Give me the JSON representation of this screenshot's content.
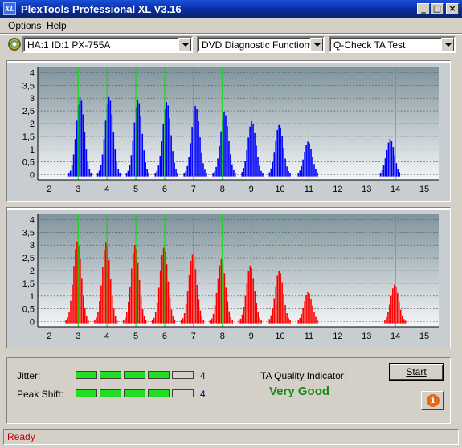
{
  "window": {
    "title": "PlexTools Professional XL V3.16",
    "logo_text": "XL"
  },
  "menu": [
    {
      "label": "Options"
    },
    {
      "label": "Help"
    }
  ],
  "toolbar": {
    "drive_select": "HA:1 ID:1  PX-755A",
    "function_select": "DVD Diagnostic Functions",
    "test_select": "Q-Check TA Test"
  },
  "chart_data": [
    {
      "type": "bar",
      "color": "#0000ff",
      "x_ticks": [
        "2",
        "3",
        "4",
        "5",
        "6",
        "7",
        "8",
        "9",
        "10",
        "11",
        "12",
        "13",
        "14",
        "15"
      ],
      "y_ticks": [
        "0",
        "0,5",
        "1",
        "1,5",
        "2",
        "2,5",
        "3",
        "3,5",
        "4"
      ],
      "xlim": [
        1.6,
        15.5
      ],
      "ylim": [
        -0.2,
        4.2
      ],
      "grid_lines_at": [
        3,
        4,
        5,
        6,
        7,
        8,
        9,
        10,
        11,
        14
      ],
      "peaks": [
        {
          "center": 3.05,
          "height": 3.05
        },
        {
          "center": 4.05,
          "height": 3.05
        },
        {
          "center": 5.05,
          "height": 2.95
        },
        {
          "center": 6.05,
          "height": 2.85
        },
        {
          "center": 7.05,
          "height": 2.7
        },
        {
          "center": 8.05,
          "height": 2.45
        },
        {
          "center": 9.0,
          "height": 2.1
        },
        {
          "center": 9.95,
          "height": 1.95
        },
        {
          "center": 10.95,
          "height": 1.3
        },
        {
          "center": 13.8,
          "height": 1.4
        }
      ]
    },
    {
      "type": "bar",
      "color": "#ff0000",
      "x_ticks": [
        "2",
        "3",
        "4",
        "5",
        "6",
        "7",
        "8",
        "9",
        "10",
        "11",
        "12",
        "13",
        "14",
        "15"
      ],
      "y_ticks": [
        "0",
        "0,5",
        "1",
        "1,5",
        "2",
        "2,5",
        "3",
        "3,5",
        "4"
      ],
      "xlim": [
        1.6,
        15.5
      ],
      "ylim": [
        -0.2,
        4.2
      ],
      "grid_lines_at": [
        3,
        4,
        5,
        6,
        7,
        8,
        9,
        10,
        11,
        14
      ],
      "peaks": [
        {
          "center": 2.95,
          "height": 3.15
        },
        {
          "center": 3.95,
          "height": 3.1
        },
        {
          "center": 4.95,
          "height": 3.0
        },
        {
          "center": 5.95,
          "height": 2.9
        },
        {
          "center": 6.95,
          "height": 2.65
        },
        {
          "center": 7.95,
          "height": 2.45
        },
        {
          "center": 8.95,
          "height": 2.2
        },
        {
          "center": 9.95,
          "height": 2.0
        },
        {
          "center": 10.95,
          "height": 1.15
        },
        {
          "center": 13.95,
          "height": 1.45
        }
      ]
    }
  ],
  "metrics": {
    "jitter_label": "Jitter:",
    "jitter_value": "4",
    "jitter_level": 4,
    "peak_label": "Peak Shift:",
    "peak_value": "4",
    "peak_level": 4,
    "max_level": 5,
    "quality_label": "TA Quality Indicator:",
    "quality_value": "Very Good"
  },
  "buttons": {
    "start": "Start",
    "info_icon": "info-icon"
  },
  "status": {
    "text": "Ready"
  },
  "colors": {
    "fill_green": "#22dd22",
    "fill_empty": "#d4d0c8"
  }
}
